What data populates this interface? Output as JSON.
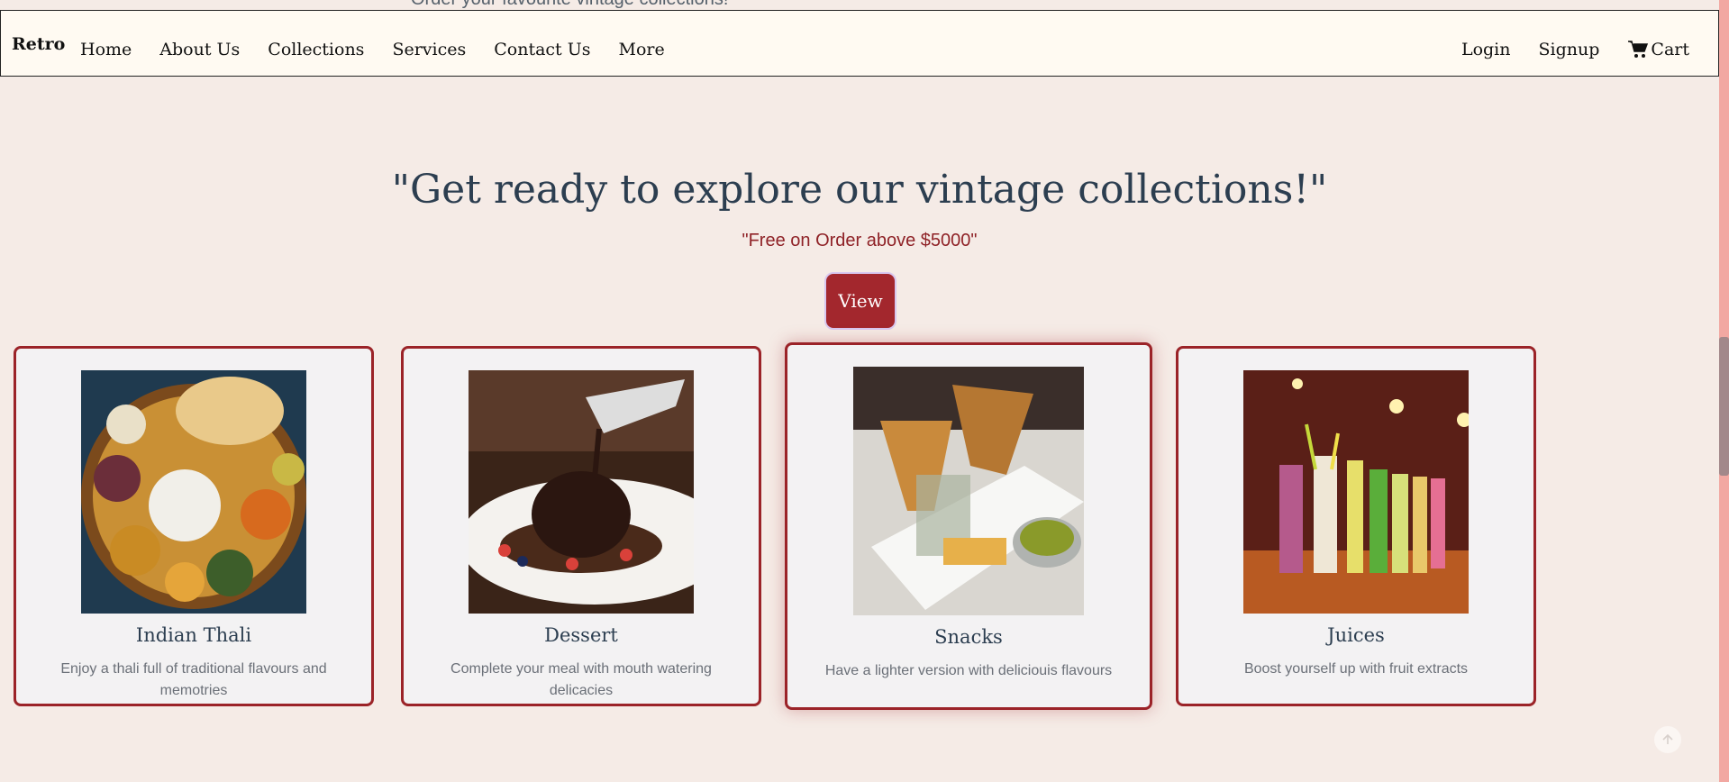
{
  "top_peek_text": "Order your favourite vintage collections!",
  "nav": {
    "brand": "Retro",
    "links": [
      "Home",
      "About Us",
      "Collections",
      "Services",
      "Contact Us",
      "More"
    ],
    "login": "Login",
    "signup": "Signup",
    "cart": "Cart"
  },
  "hero": {
    "title": "\"Get ready to explore our vintage collections!\"",
    "subtitle": "\"Free on Order above $5000\"",
    "button": "View"
  },
  "cards": [
    {
      "title": "Indian Thali",
      "desc": "Enjoy a thali full of traditional flavours and memotries",
      "image_icon": "thali-image"
    },
    {
      "title": "Dessert",
      "desc": "Complete your meal with mouth watering delicacies",
      "image_icon": "dessert-image"
    },
    {
      "title": "Snacks",
      "desc": "Have a lighter version with deliciouis flavours",
      "image_icon": "snacks-image"
    },
    {
      "title": "Juices",
      "desc": "Boost yourself up with fruit extracts",
      "image_icon": "juices-image"
    }
  ],
  "colors": {
    "accent": "#a3272d",
    "background": "#f5ebe6",
    "navbar": "#fffaf2",
    "heading": "#2c3e50",
    "scrollbar": "#f2a8a2"
  },
  "icons": {
    "cart": "cart-icon",
    "back_to_top": "arrow-up-icon"
  }
}
